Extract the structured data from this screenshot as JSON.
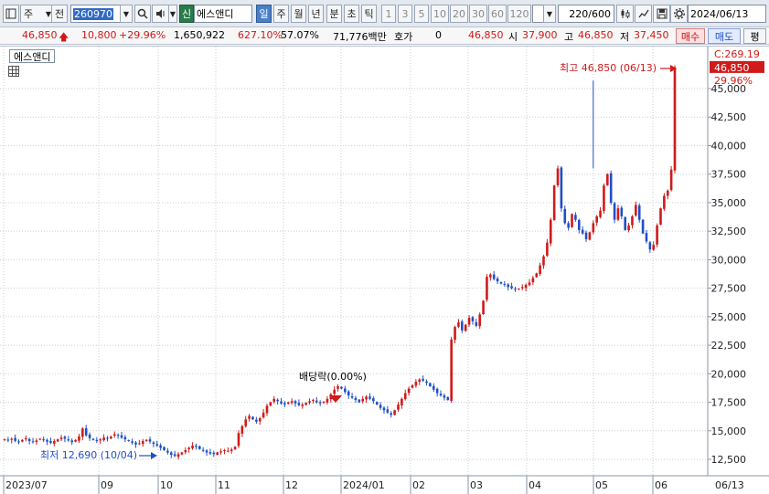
{
  "toolbar": {
    "market_type": "주",
    "prefix": "전",
    "stock_code": "260970",
    "sin_badge": "신",
    "stock_name": "에스앤디",
    "periods": [
      "일",
      "주",
      "월",
      "년",
      "분",
      "초",
      "틱"
    ],
    "active_period": "일",
    "intervals": [
      "1",
      "3",
      "5",
      "10",
      "20",
      "30",
      "60",
      "120"
    ],
    "interval_input": "",
    "count": "220",
    "count_total": "/600",
    "date": "2024/06/13"
  },
  "quote": {
    "price": "46,850",
    "change": "10,800",
    "change_pct": "+29.96%",
    "volume": "1,650,922",
    "volume_ratio": "627.10%",
    "turnover": "57.07%",
    "amount": "71,776백만",
    "hoga_label": "호가",
    "hoga_value": "0",
    "hoga_price": "46,850",
    "open_label": "시",
    "open": "37,900",
    "high_label": "고",
    "high": "46,850",
    "low_label": "저",
    "low": "37,450",
    "buy_label": "매수",
    "sell_label": "매도",
    "eval_label": "평"
  },
  "chart": {
    "stock_tag": "에스앤디",
    "annotations": {
      "high_label": "최고 46,850 (06/13)",
      "low_label": "최저 12,690 (10/04)",
      "dividend_label": "배당락(0.00%)"
    },
    "right_axis": {
      "top_label": "C:269.19",
      "current_price": "46,850",
      "current_pct": "29.96%"
    },
    "y_ticks": [
      "45,000",
      "42,500",
      "40,000",
      "37,500",
      "35,000",
      "32,500",
      "30,000",
      "27,500",
      "25,000",
      "22,500",
      "20,000",
      "17,500",
      "15,000",
      "12,500"
    ],
    "x_ticks": [
      "2023/07",
      "09",
      "10",
      "11",
      "12",
      "2024/01",
      "02",
      "03",
      "04",
      "05",
      "06"
    ],
    "x_end_label": "06/13",
    "colors": {
      "up": "#d11a1a",
      "down": "#1f4fc7",
      "grid": "#c9ced6"
    }
  },
  "chart_data": {
    "type": "candlestick",
    "title": "",
    "xlabel": "",
    "ylabel": "",
    "ylim": [
      11500,
      48000
    ],
    "x_start": "2023/07",
    "x_end": "2024/06/13",
    "series": [
      {
        "values": [
          14250,
          14180,
          14300,
          14120,
          14050,
          14200,
          14350,
          14100,
          14000,
          14150,
          14300,
          14200,
          14050,
          13950,
          14100,
          14250,
          14400,
          14300,
          14150,
          14000,
          14200,
          14500,
          15200,
          14600,
          14350,
          14200,
          14100,
          14250,
          14400,
          14300,
          14500,
          14700,
          14600,
          14400,
          14250,
          14100,
          13950,
          13800,
          13900,
          14100,
          14200,
          14050,
          13850,
          13700,
          13500,
          13300,
          13100,
          12900,
          12800,
          12950,
          13100,
          13300,
          13500,
          13700,
          13600,
          13400,
          13300,
          13100,
          13000,
          12950,
          13100,
          13200,
          13300,
          13250,
          13350,
          13600,
          14800,
          15400,
          16000,
          16300,
          16000,
          15800,
          16100,
          16600,
          17200,
          17500,
          17800,
          17600,
          17400,
          17300,
          17500,
          17600,
          17400,
          17250,
          17300,
          17450,
          17600,
          17700,
          17500,
          17400,
          17550,
          17800,
          18200,
          18600,
          18900,
          18700,
          18400,
          18100,
          17900,
          17700,
          17500,
          17800,
          18000,
          17800,
          17600,
          17300,
          17000,
          16800,
          16600,
          16400,
          16800,
          17300,
          17800,
          18300,
          18700,
          19000,
          19300,
          19500,
          19400,
          19200,
          18900,
          18600,
          18300,
          18100,
          17900,
          17700,
          23000,
          24100,
          24500,
          23800,
          24300,
          24900,
          24600,
          24200,
          25200,
          26400,
          28500,
          28700,
          28300,
          28100,
          27900,
          27800,
          27600,
          27500,
          27400,
          27450,
          27600,
          27800,
          28000,
          28400,
          28800,
          29500,
          30300,
          31500,
          33500,
          36500,
          38000,
          34500,
          33200,
          32800,
          34000,
          33500,
          32600,
          32300,
          31800,
          32400,
          33200,
          33800,
          34300,
          36500,
          37500,
          35000,
          33500,
          34500,
          33800,
          32600,
          33000,
          33800,
          34800,
          33500,
          32300,
          31600,
          30900,
          31300,
          33000,
          34500,
          35600,
          36050,
          37900,
          46850
        ],
        "high": 46850,
        "low": 12690,
        "high_date": "06/13",
        "low_date": "10/04"
      }
    ]
  }
}
